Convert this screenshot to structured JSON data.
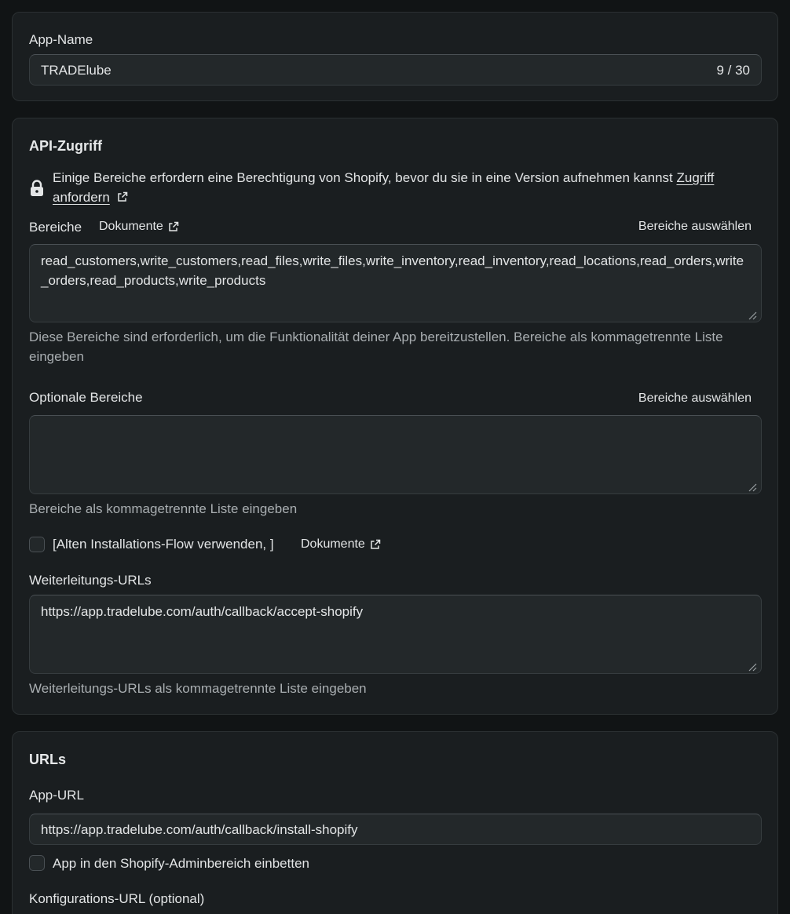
{
  "app_name_card": {
    "label": "App-Name",
    "value": "TRADElube",
    "counter": "9 / 30"
  },
  "api_card": {
    "heading": "API-Zugriff",
    "notice_text": "Einige Bereiche erfordern eine Berechtigung von Shopify, bevor du sie in eine Version aufnehmen kannst",
    "notice_link_line1": "Zugriff",
    "notice_link_line2": "anfordern",
    "scopes": {
      "label": "Bereiche",
      "docs_label": "Dokumente",
      "select_label": "Bereiche auswählen",
      "value": "read_customers,write_customers,read_files,write_files,write_inventory,read_inventory,read_locations,read_orders,write_orders,read_products,write_products",
      "help": "Diese Bereiche sind erforderlich, um die Funktionalität deiner App bereitzustellen. Bereiche als kommagetrennte Liste eingeben"
    },
    "optional_scopes": {
      "label": "Optionale Bereiche",
      "select_label": "Bereiche auswählen",
      "value": "",
      "help": "Bereiche als kommagetrennte Liste eingeben"
    },
    "legacy_flow": {
      "label": "[Alten Installations-Flow verwenden, ]",
      "docs_label": "Dokumente"
    },
    "redirect_urls": {
      "label": "Weiterleitungs-URLs",
      "value": "https://app.tradelube.com/auth/callback/accept-shopify",
      "help": "Weiterleitungs-URLs als kommagetrennte Liste eingeben"
    }
  },
  "urls_card": {
    "heading": "URLs",
    "app_url_label": "App-URL",
    "app_url_value": "https://app.tradelube.com/auth/callback/install-shopify",
    "embed_label": "App in den Shopify-Adminbereich einbetten",
    "config_url_label": "Konfigurations-URL (optional)"
  }
}
